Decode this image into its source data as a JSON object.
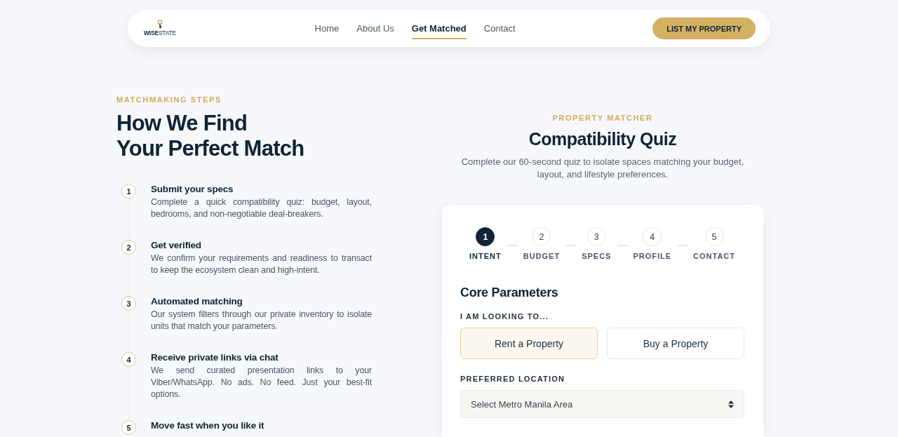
{
  "nav": {
    "logo": "**WISE**STATE",
    "links": [
      {
        "label": "Home",
        "selected": false
      },
      {
        "label": "About Us",
        "selected": false
      },
      {
        "label": "Get Matched",
        "selected": true
      },
      {
        "label": "Contact",
        "selected": false
      }
    ],
    "cta": "LIST MY PROPERTY"
  },
  "matchmaking": {
    "eyebrow": "MATCHMAKING STEPS",
    "title": "How We Find\nYour Perfect Match",
    "steps": [
      {
        "number": "1",
        "title": "Submit your specs",
        "text": "Complete a quick compatibility quiz: budget, layout, bedrooms, and non-negotiable deal-breakers."
      },
      {
        "number": "2",
        "title": "Get verified",
        "text": "We confirm your requirements and readiness to transact to keep the ecosystem clean and high-intent."
      },
      {
        "number": "3",
        "title": "Automated matching",
        "text": "Our system filters through our private inventory to isolate units that match your parameters."
      },
      {
        "number": "4",
        "title": "Receive private links via chat",
        "text": "We send curated presentation links to your Viber/WhatsApp. No ads. No feed. Just your best-fit options."
      },
      {
        "number": "5",
        "title": "Move fast when you like it"
      }
    ]
  },
  "quiz": {
    "eyebrow": "PROPERTY MATCHER",
    "title": "Compatibility Quiz",
    "description": "Complete our 60-second quiz to isolate spaces matching your budget, layout, and lifestyle preferences.",
    "progress": [
      {
        "number": "1",
        "label": "INTENT",
        "selected": true
      },
      {
        "number": "2",
        "label": "BUDGET",
        "selected": false
      },
      {
        "number": "3",
        "label": "SPECS",
        "selected": false
      },
      {
        "number": "4",
        "label": "PROFILE",
        "selected": false
      },
      {
        "number": "5",
        "label": "CONTACT",
        "selected": false
      }
    ],
    "section_title": "Core Parameters",
    "fields": [
      {
        "kind": "choice",
        "label": "I AM LOOKING TO...",
        "options": [
          {
            "label": "Rent a Property",
            "selected": true
          },
          {
            "label": "Buy a Property",
            "selected": false
          }
        ]
      },
      {
        "kind": "select",
        "label": "PREFERRED LOCATION",
        "placeholder": "Select Metro Manila Area"
      }
    ]
  }
}
